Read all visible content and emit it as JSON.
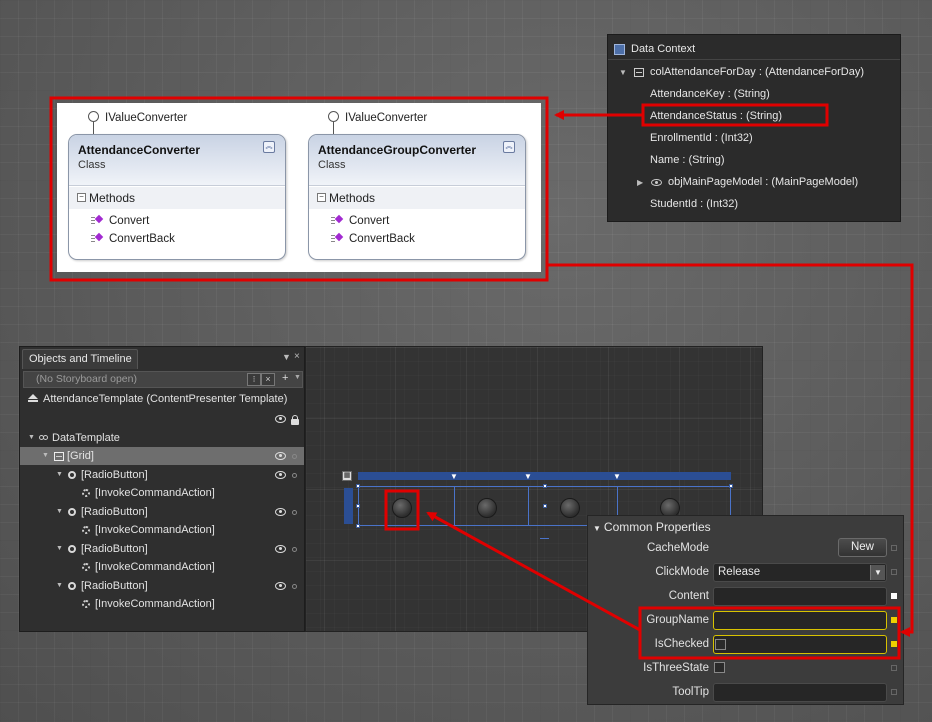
{
  "data_context": {
    "title": "Data Context",
    "collection": "colAttendanceForDay : (AttendanceForDay)",
    "fields": [
      "AttendanceKey : (String)",
      "AttendanceStatus : (String)",
      "EnrollmentId : (Int32)",
      "Name : (String)",
      "objMainPageModel : (MainPageModel)",
      "StudentId : (Int32)"
    ]
  },
  "class_diagram": {
    "classes": [
      {
        "interface": "IValueConverter",
        "name": "AttendanceConverter",
        "kind": "Class",
        "section": "Methods",
        "methods": [
          "Convert",
          "ConvertBack"
        ]
      },
      {
        "interface": "IValueConverter",
        "name": "AttendanceGroupConverter",
        "kind": "Class",
        "section": "Methods",
        "methods": [
          "Convert",
          "ConvertBack"
        ]
      }
    ]
  },
  "objects_panel": {
    "tab_title": "Objects and Timeline",
    "storyboard_placeholder": "(No Storyboard open)",
    "template_title": "AttendanceTemplate (ContentPresenter Template)",
    "tree": {
      "data_template": "DataTemplate",
      "grid": "[Grid]",
      "radio_button": "[RadioButton]",
      "invoke_action": "[InvokeCommandAction]"
    }
  },
  "properties": {
    "section": "Common Properties",
    "rows": {
      "cache_mode": {
        "label": "CacheMode",
        "button": "New"
      },
      "click_mode": {
        "label": "ClickMode",
        "value": "Release"
      },
      "content": {
        "label": "Content",
        "value": ""
      },
      "group_name": {
        "label": "GroupName",
        "value": ""
      },
      "is_checked": {
        "label": "IsChecked"
      },
      "is_three_state": {
        "label": "IsThreeState"
      },
      "tooltip": {
        "label": "ToolTip",
        "value": ""
      }
    }
  },
  "colors": {
    "callout": "#e00000",
    "selection_blue": "#2b4e94",
    "highlight_yellow": "#d8c200"
  }
}
